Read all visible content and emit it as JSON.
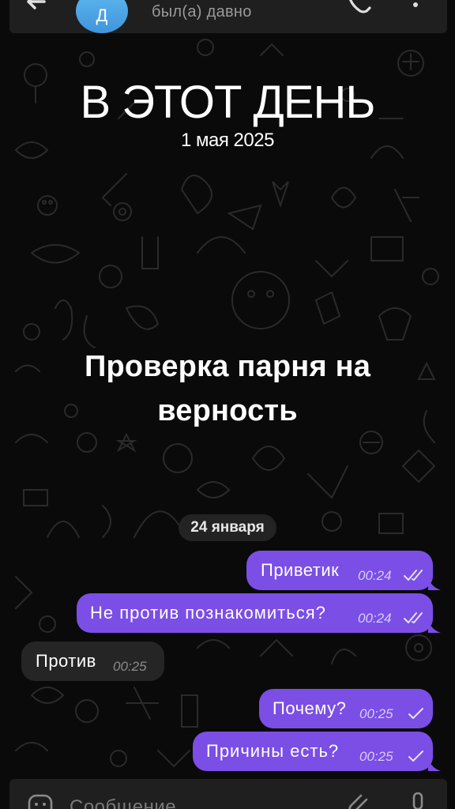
{
  "header": {
    "avatar_letter": "Д",
    "status": "был(а) давно",
    "icons": [
      "back-arrow-icon",
      "phone-icon",
      "more-vertical-icon"
    ]
  },
  "overlay": {
    "title": "В ЭТОТ ДЕНЬ",
    "date": "1 мая 2025",
    "caption": "Проверка парня на верность"
  },
  "chat": {
    "date_chip": "24 января",
    "messages": [
      {
        "direction": "out",
        "text": "Приветик",
        "time": "00:24",
        "status": "read"
      },
      {
        "direction": "out",
        "text": "Не против познакомиться?",
        "time": "00:24",
        "status": "read"
      },
      {
        "direction": "in",
        "text": "Против",
        "time": "00:25"
      },
      {
        "direction": "out",
        "text": "Почему?",
        "time": "00:25",
        "status": "sent"
      },
      {
        "direction": "out",
        "text": "Причины есть?",
        "time": "00:25",
        "status": "sent"
      }
    ]
  },
  "input": {
    "placeholder": "Сообщение",
    "icons": [
      "emoji-icon",
      "attach-icon",
      "microphone-icon"
    ]
  },
  "colors": {
    "outgoing_bubble": "#7b4ee6",
    "incoming_bubble": "#252525",
    "background": "#0a0a0a",
    "avatar": "#4aa3e4"
  }
}
